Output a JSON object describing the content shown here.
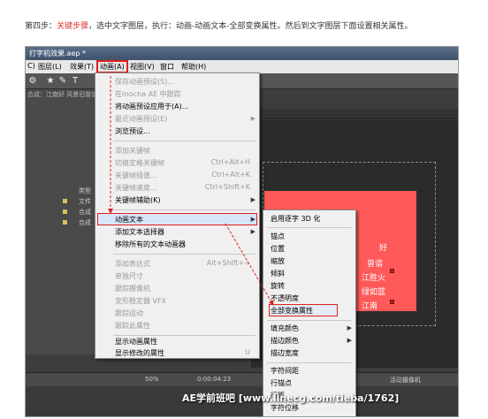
{
  "instruction": {
    "step": "第四步：",
    "highlight": "关键步骤",
    "rest": "，选中文字图层，执行：动画-动画文本-全部变换属性。然后到文字图层下面设置相关属性。"
  },
  "window": {
    "title": "打字机效果.aep *"
  },
  "menubar": [
    "C)",
    "图层(L)",
    "效果(T)",
    "动画(A)",
    "视图(V)",
    "窗口",
    "帮助(H)"
  ],
  "toolbar_icons": [
    "tool-icon",
    "star-icon",
    "pen-icon",
    "text-icon"
  ],
  "project_panel": {
    "tab": "合成：江南好  风景旧曾谙",
    "col_header": "类型",
    "rows": [
      "文件",
      "合成",
      "合成"
    ]
  },
  "timeline_ruler": "",
  "animation_menu": {
    "items": [
      {
        "label": "保存动画预设(S)...",
        "disabled": true
      },
      {
        "label": "在mocha AE 中跟踪",
        "disabled": true
      },
      {
        "label": "将动画预设应用于(A)...",
        "disabled": false
      },
      {
        "label": "最近动画预设(E)",
        "disabled": true,
        "submenu": true
      },
      {
        "label": "浏览预设...",
        "disabled": false
      },
      {
        "sep": true
      },
      {
        "label": "添加关键帧",
        "disabled": true
      },
      {
        "label": "切换定格关键帧",
        "shortcut": "Ctrl+Alt+H",
        "disabled": true
      },
      {
        "label": "关键帧插值...",
        "shortcut": "Ctrl+Alt+K",
        "disabled": true
      },
      {
        "label": "关键帧速度...",
        "shortcut": "Ctrl+Shift+K",
        "disabled": true
      },
      {
        "label": "关键帧辅助(K)",
        "disabled": false,
        "submenu": true
      },
      {
        "sep": true
      },
      {
        "label": "动画文本",
        "disabled": false,
        "submenu": true,
        "selected": true
      },
      {
        "label": "添加文本选择器",
        "disabled": false,
        "submenu": true
      },
      {
        "label": "移除所有的文本动画器",
        "disabled": false
      },
      {
        "sep": true
      },
      {
        "label": "添加表达式",
        "shortcut": "Alt+Shift+=",
        "disabled": true
      },
      {
        "label": "单独尺寸",
        "disabled": true
      },
      {
        "label": "跟踪摄像机",
        "disabled": true
      },
      {
        "label": "变形稳定器 VFX",
        "disabled": true
      },
      {
        "label": "跟踪运动",
        "disabled": true
      },
      {
        "label": "跟踪此属性",
        "disabled": true
      },
      {
        "sep": true
      },
      {
        "label": "显示动画属性",
        "disabled": false
      },
      {
        "label": "显示修改的属性",
        "shortcut": "U",
        "disabled": false
      }
    ]
  },
  "text_animate_submenu": {
    "items": [
      {
        "label": "启用逐字 3D 化"
      },
      {
        "sep": true
      },
      {
        "label": "锚点"
      },
      {
        "label": "位置"
      },
      {
        "label": "缩放"
      },
      {
        "label": "倾斜"
      },
      {
        "label": "旋转"
      },
      {
        "label": "不透明度"
      },
      {
        "label": "全部变换属性",
        "highlighted": true
      },
      {
        "sep": true
      },
      {
        "label": "填充颜色",
        "submenu": true
      },
      {
        "label": "描边颜色",
        "submenu": true
      },
      {
        "label": "描边宽度"
      },
      {
        "sep": true
      },
      {
        "label": "字符间距"
      },
      {
        "label": "行锚点"
      },
      {
        "label": "行距"
      },
      {
        "label": "字符位移"
      }
    ]
  },
  "composition": {
    "poem_lines": [
      "好",
      "曾谙",
      "江胜火",
      "绿如蓝",
      "江南"
    ]
  },
  "bottom_bar": {
    "zoom": "50%",
    "timecode": "0:00:04:23",
    "camera": "活动摄像机"
  },
  "watermark": "AE学前班吧 [www.linecg.com/tieba/1762]",
  "colors": {
    "accent_red": "#e02020",
    "comp_red": "#ff5a5a",
    "menu_bg": "#f0f0f0",
    "highlight": "#d6e6f8"
  }
}
